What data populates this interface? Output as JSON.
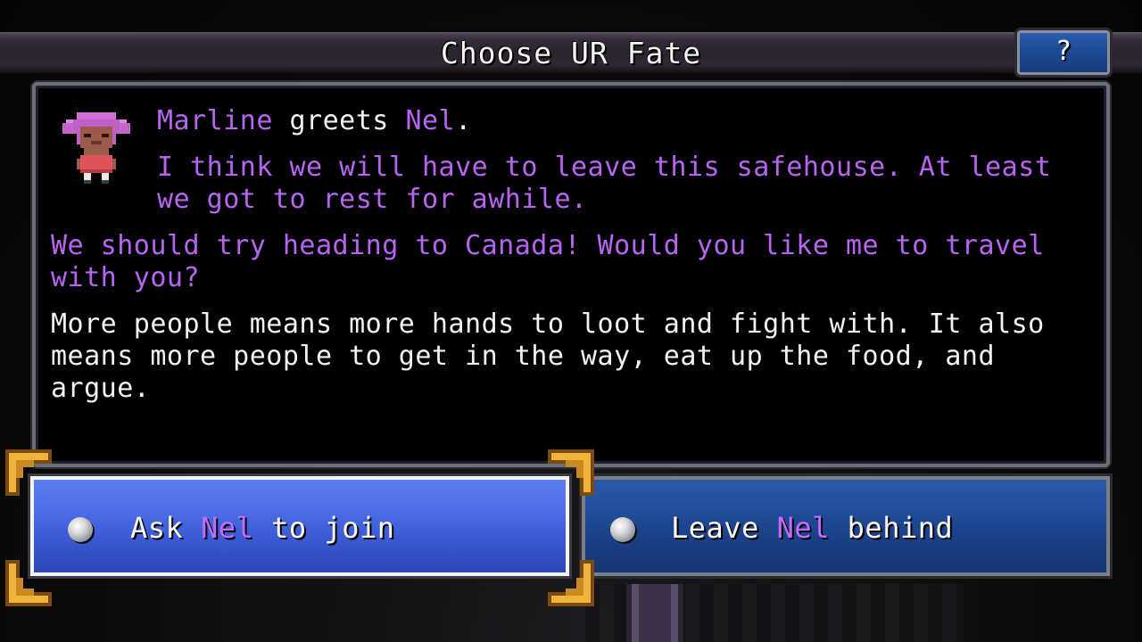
{
  "window": {
    "title": "Choose UR Fate",
    "help_label": "?"
  },
  "dialogue": {
    "speaker": "Marline",
    "greet_verb": "greets",
    "target": "Nel",
    "greet_end": ".",
    "quote_line1": "I think we will have to leave this safehouse. At least we got to rest for awhile.",
    "quote_line2": "We should try heading to Canada! Would you like me to travel with you?",
    "narration": "More people means more hands to loot and fight with. It also means more people to get in the way, eat up the food, and argue."
  },
  "choices": [
    {
      "pre": "Ask ",
      "name": "Nel",
      "post": " to join",
      "selected": true
    },
    {
      "pre": "Leave ",
      "name": "Nel",
      "post": " behind",
      "selected": false
    }
  ],
  "colors": {
    "name_purple": "#b864f2",
    "selected_button": "#4f70e8",
    "unselected_button": "#214c98",
    "corner_gold": "#e0a22c"
  },
  "icons": {
    "portrait": "marline-portrait",
    "radio": "radio-bullet-icon",
    "corners": "selection-corner-icon"
  }
}
